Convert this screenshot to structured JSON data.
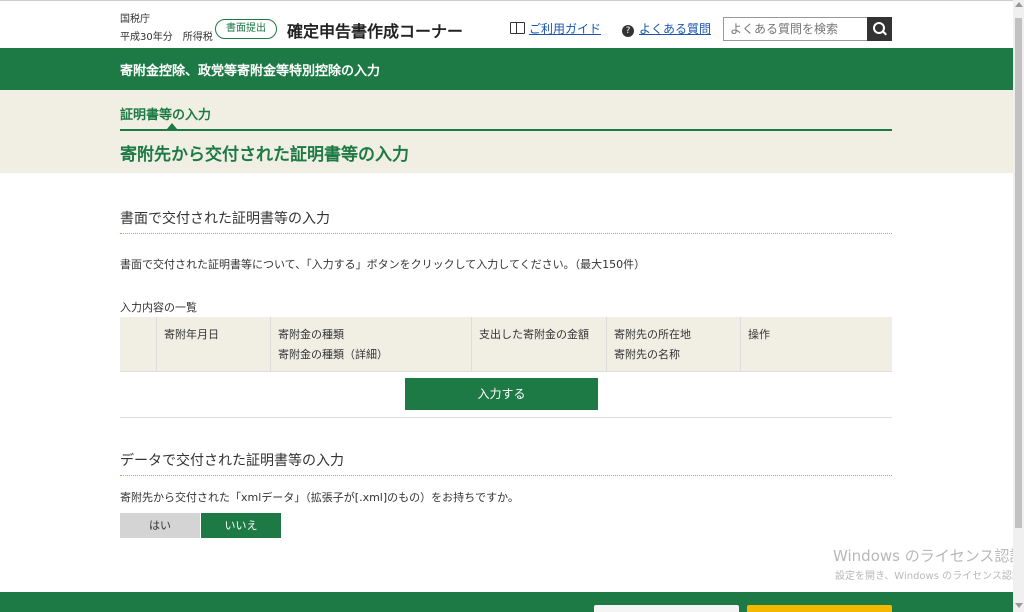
{
  "header": {
    "agency": "国税庁",
    "tax_year": "平成30年分　所得税",
    "submit_badge": "書面提出",
    "site_title": "確定申告書作成コーナー",
    "guide_link": "ご利用ガイド",
    "faq_link": "よくある質問",
    "search_placeholder": "よくある質問を検索"
  },
  "band": {
    "title": "寄附金控除、政党等寄附金等特別控除の入力"
  },
  "step": {
    "label": "証明書等の入力",
    "page_title": "寄附先から交付された証明書等の入力"
  },
  "paper_section": {
    "title": "書面で交付された証明書等の入力",
    "description": "書面で交付された証明書等について、「入力する」ボタンをクリックして入力してください。（最大150件）",
    "list_caption": "入力内容の一覧",
    "columns": {
      "date": "寄附年月日",
      "type": "寄附金の種類",
      "type_detail": "寄附金の種類（詳細）",
      "amount": "支出した寄附金の金額",
      "address": "寄附先の所在地",
      "name": "寄附先の名称",
      "ops": "操作"
    },
    "input_button": "入力する"
  },
  "data_section": {
    "title": "データで交付された証明書等の入力",
    "question": "寄附先から交付された「xmlデータ」（拡張子が[.xml]のもの）をお持ちですか。",
    "yes": "はい",
    "no": "いいえ",
    "selected": "いいえ"
  },
  "watermark": {
    "line1": "Windows のライセンス認証",
    "line2": "設定を開き、Windows のライセンス認証を"
  },
  "colors": {
    "brand_green": "#1d7a45",
    "beige": "#f1efe4",
    "accent_orange": "#e0a020",
    "footer_yellow": "#f5b800"
  }
}
